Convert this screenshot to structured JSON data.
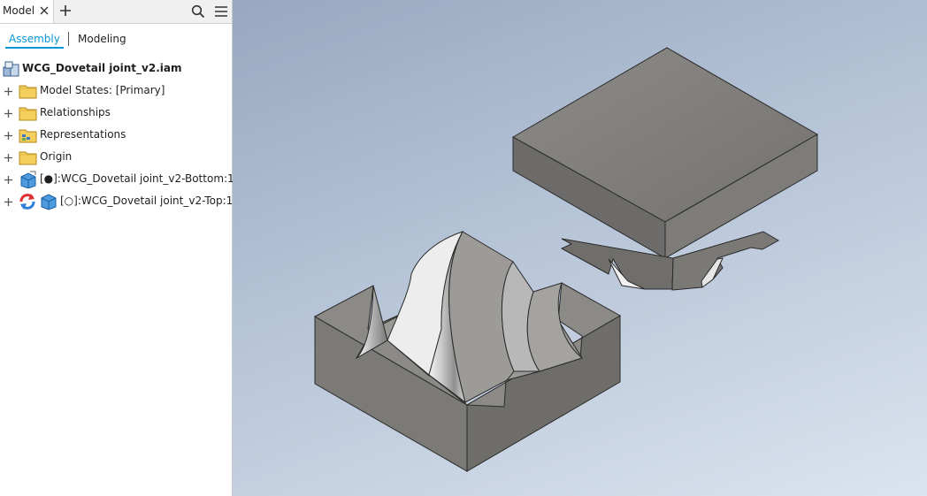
{
  "panel": {
    "tab_label": "Model",
    "modes": {
      "assembly": "Assembly",
      "modeling": "Modeling"
    },
    "root": "WCG_Dovetail joint_v2.iam",
    "items": [
      {
        "label": "Model States: [Primary]",
        "icon": "folder-icon"
      },
      {
        "label": "Relationships",
        "icon": "folder-icon"
      },
      {
        "label": "Representations",
        "icon": "representations-folder-icon"
      },
      {
        "label": "Origin",
        "icon": "folder-icon"
      },
      {
        "label": "[●]:WCG_Dovetail joint_v2-Bottom:1",
        "icon": "part-icon"
      },
      {
        "label": "[○]:WCG_Dovetail joint_v2-Top:1",
        "icon": "part-icon",
        "status_icon": "update-needed-icon"
      }
    ]
  },
  "viewport": {
    "background_colors": [
      "#97a8c0",
      "#dbe4ef"
    ]
  }
}
